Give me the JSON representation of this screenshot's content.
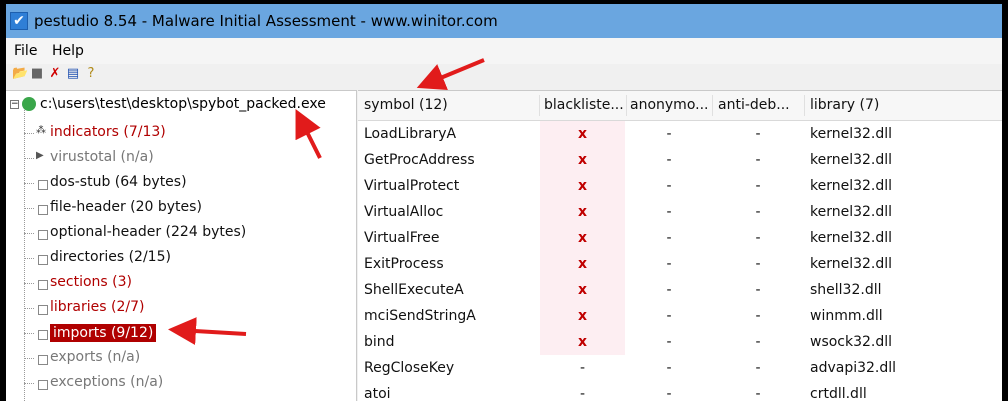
{
  "window": {
    "title": "pestudio 8.54 - Malware Initial Assessment - www.winitor.com",
    "title_icon": "checkbox-icon"
  },
  "menu": {
    "items": [
      "File",
      "Help"
    ]
  },
  "toolbar": {
    "icons": [
      "open-folder-icon",
      "save-icon",
      "delete-icon",
      "list-icon",
      "about-icon"
    ]
  },
  "tree": {
    "root": "c:\\users\\test\\desktop\\spybot_packed.exe",
    "items": [
      {
        "label": "indicators (7/13)",
        "style": "red",
        "icon": "indicators-icon"
      },
      {
        "label": "virustotal (n/a)",
        "style": "grey",
        "icon": "virustotal-icon"
      },
      {
        "label": "dos-stub (64 bytes)",
        "style": "dark",
        "icon": "square-icon"
      },
      {
        "label": "file-header (20 bytes)",
        "style": "dark",
        "icon": "square-icon"
      },
      {
        "label": "optional-header (224 bytes)",
        "style": "dark",
        "icon": "square-icon"
      },
      {
        "label": "directories (2/15)",
        "style": "dark",
        "icon": "square-icon"
      },
      {
        "label": "sections (3)",
        "style": "red",
        "icon": "square-icon"
      },
      {
        "label": "libraries (2/7)",
        "style": "red",
        "icon": "square-icon"
      },
      {
        "label": "imports (9/12)",
        "style": "selected",
        "icon": "square-icon"
      },
      {
        "label": "exports (n/a)",
        "style": "grey",
        "icon": "square-icon"
      },
      {
        "label": "exceptions (n/a)",
        "style": "grey",
        "icon": "square-icon"
      }
    ]
  },
  "table": {
    "columns": [
      "symbol (12)",
      "blackliste...",
      "anonymo...",
      "anti-deb...",
      "library (7)"
    ],
    "rows": [
      {
        "symbol": "LoadLibraryA",
        "blacklisted": "x",
        "anonymous": "-",
        "anti_debug": "-",
        "library": "kernel32.dll"
      },
      {
        "symbol": "GetProcAddress",
        "blacklisted": "x",
        "anonymous": "-",
        "anti_debug": "-",
        "library": "kernel32.dll"
      },
      {
        "symbol": "VirtualProtect",
        "blacklisted": "x",
        "anonymous": "-",
        "anti_debug": "-",
        "library": "kernel32.dll"
      },
      {
        "symbol": "VirtualAlloc",
        "blacklisted": "x",
        "anonymous": "-",
        "anti_debug": "-",
        "library": "kernel32.dll"
      },
      {
        "symbol": "VirtualFree",
        "blacklisted": "x",
        "anonymous": "-",
        "anti_debug": "-",
        "library": "kernel32.dll"
      },
      {
        "symbol": "ExitProcess",
        "blacklisted": "x",
        "anonymous": "-",
        "anti_debug": "-",
        "library": "kernel32.dll"
      },
      {
        "symbol": "ShellExecuteA",
        "blacklisted": "x",
        "anonymous": "-",
        "anti_debug": "-",
        "library": "shell32.dll"
      },
      {
        "symbol": "mciSendStringA",
        "blacklisted": "x",
        "anonymous": "-",
        "anti_debug": "-",
        "library": "winmm.dll"
      },
      {
        "symbol": "bind",
        "blacklisted": "x",
        "anonymous": "-",
        "anti_debug": "-",
        "library": "wsock32.dll"
      },
      {
        "symbol": "RegCloseKey",
        "blacklisted": "-",
        "anonymous": "-",
        "anti_debug": "-",
        "library": "advapi32.dll"
      },
      {
        "symbol": "atoi",
        "blacklisted": "-",
        "anonymous": "-",
        "anti_debug": "-",
        "library": "crtdll.dll"
      }
    ]
  },
  "annotations": {
    "arrows": [
      "arrow-to-header",
      "arrow-to-filename",
      "arrow-to-imports"
    ],
    "color": "#e11b1b"
  },
  "colors": {
    "titlebar": "#6aa6e0",
    "selected": "#b00000",
    "blacklist_bg": "#fdeef2",
    "red_text": "#b00000"
  }
}
